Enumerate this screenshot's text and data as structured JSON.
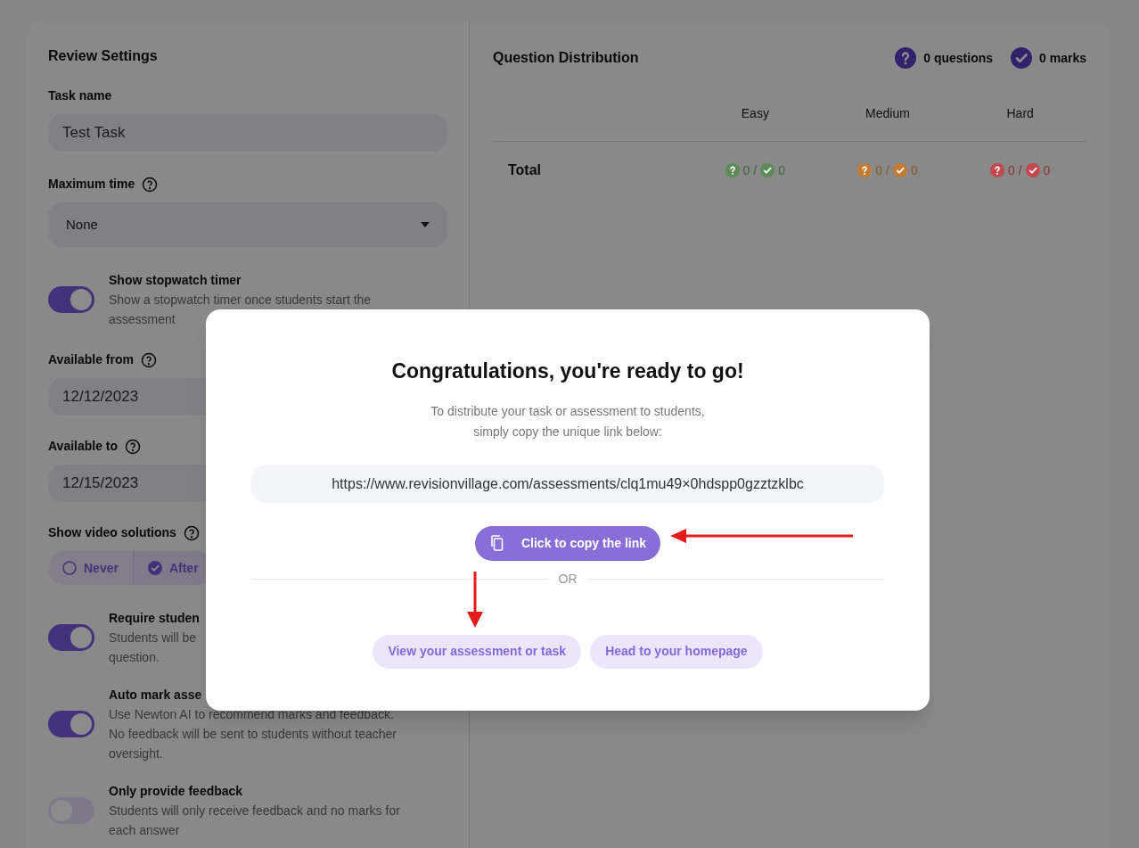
{
  "settings": {
    "title": "Review Settings",
    "task_name": {
      "label": "Task name",
      "value": "Test Task"
    },
    "maximum_time": {
      "label": "Maximum time",
      "value": "None"
    },
    "stopwatch": {
      "title": "Show stopwatch timer",
      "lines": [
        "Show a stopwatch timer once students start the",
        "assessment"
      ],
      "on": true
    },
    "available_from": {
      "label": "Available from",
      "value": "12/12/2023"
    },
    "available_to": {
      "label": "Available to",
      "value": "12/15/2023"
    },
    "video_solutions": {
      "label": "Show video solutions",
      "options": [
        {
          "label": "Never",
          "selected": false
        },
        {
          "label": "After",
          "selected": true
        }
      ]
    },
    "toggles": [
      {
        "title": "Require studen",
        "lines": [
          "Students will be",
          "question."
        ],
        "on": true
      },
      {
        "title": "Auto mark asse",
        "lines": [
          "Use Newton AI to recommend marks and feedback.",
          "No feedback will be sent to students without teacher",
          "oversight."
        ],
        "on": true
      },
      {
        "title": "Only provide feedback",
        "lines": [
          "Students will only receive feedback and no marks for",
          "each answer"
        ],
        "on": false
      }
    ]
  },
  "distribution": {
    "title": "Question Distribution",
    "questions": "0 questions",
    "marks": "0 marks",
    "columns": [
      "Easy",
      "Medium",
      "Hard"
    ],
    "rows": [
      {
        "label": "Total",
        "cells": [
          {
            "questions": "0",
            "separator": "/",
            "marks": "0",
            "color": "#5c8b57"
          },
          {
            "questions": "0",
            "separator": "/",
            "marks": "0",
            "color": "#c27b30"
          },
          {
            "questions": "0",
            "separator": "/",
            "marks": "0",
            "color": "#c2474e"
          }
        ]
      }
    ]
  },
  "modal": {
    "title": "Congratulations, you're ready to go!",
    "lines": [
      "To distribute your task or assessment to students,",
      "simply copy the unique link below:"
    ],
    "link": "https://www.revisionvillage.com/assessments/clq1mu49×0hdspp0gzztzklbc",
    "copy_button": "Click to copy the link",
    "divider": "OR",
    "buttons": [
      "View your assessment or task",
      "Head to your homepage"
    ]
  }
}
